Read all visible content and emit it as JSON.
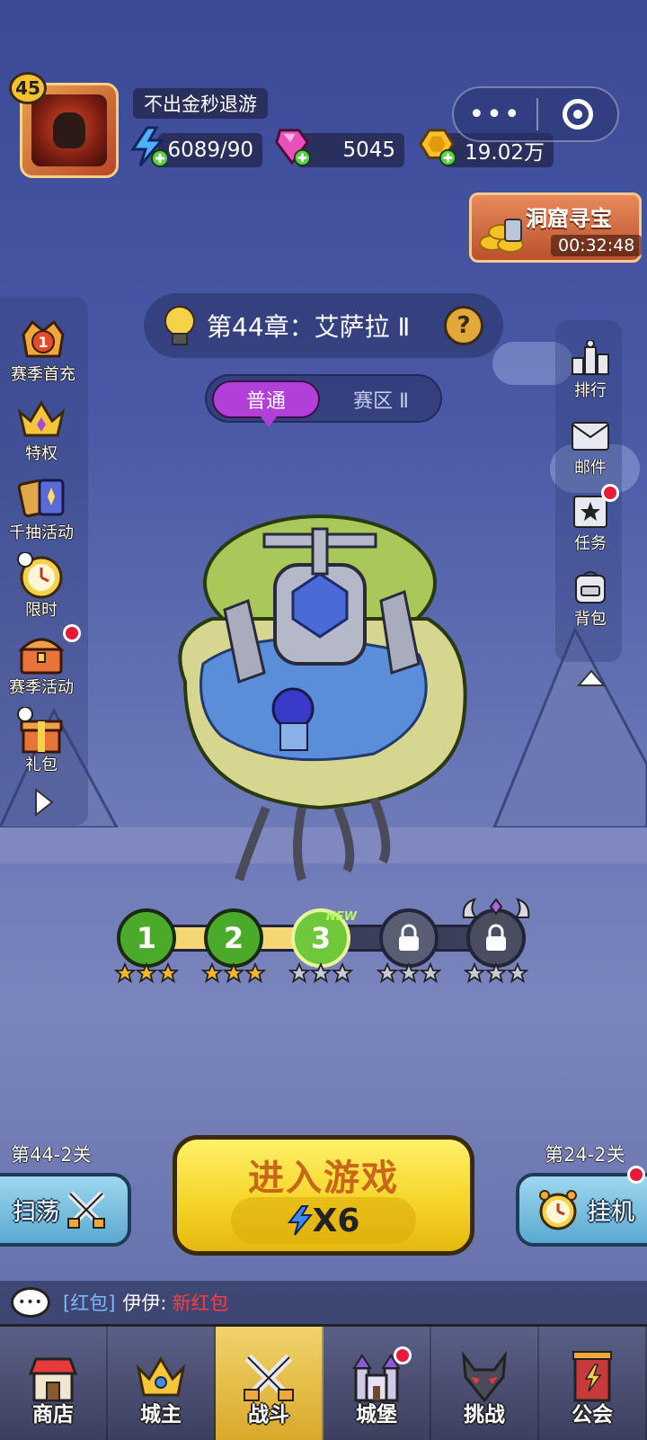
{
  "player": {
    "level": "45",
    "name": "不出金秒退游"
  },
  "resources": {
    "energy": "6089/90",
    "gems": "5045",
    "gold": "19.02万"
  },
  "capsule": {
    "more_icon": "more-dots-icon",
    "close_icon": "target-icon"
  },
  "cave_treasure": {
    "title": "洞窟寻宝",
    "timer": "00:32:48"
  },
  "chapter": {
    "title": "第44章：艾萨拉 Ⅱ",
    "help": "?"
  },
  "mode_tabs": {
    "normal": "普通",
    "zone": "赛区 Ⅱ"
  },
  "left_menu": [
    {
      "label": "赛季首充",
      "icon": "crown-badge-icon",
      "badge": "1"
    },
    {
      "label": "特权",
      "icon": "crown-icon"
    },
    {
      "label": "千抽活动",
      "icon": "cards-icon"
    },
    {
      "label": "限时",
      "icon": "clock-icon"
    },
    {
      "label": "赛季活动",
      "icon": "chest-icon"
    },
    {
      "label": "礼包",
      "icon": "gift-icon"
    }
  ],
  "right_menu": [
    {
      "label": "排行",
      "icon": "ranking-icon"
    },
    {
      "label": "邮件",
      "icon": "mail-icon"
    },
    {
      "label": "任务",
      "icon": "task-icon"
    },
    {
      "label": "背包",
      "icon": "backpack-icon"
    }
  ],
  "stages": [
    {
      "num": "1",
      "stars": 3,
      "state": "cleared"
    },
    {
      "num": "2",
      "stars": 3,
      "state": "cleared"
    },
    {
      "num": "3",
      "stars": 0,
      "state": "current",
      "tag": "NEW"
    },
    {
      "num": "",
      "stars": 0,
      "state": "locked"
    },
    {
      "num": "",
      "stars": 0,
      "state": "boss-locked"
    }
  ],
  "sweep": {
    "level": "第44-2关",
    "label": "扫荡"
  },
  "idle": {
    "level": "第24-2关",
    "label": "挂机"
  },
  "enter": {
    "title": "进入游戏",
    "cost": "X6"
  },
  "chat": {
    "tag": "[红包]",
    "user": "伊伊:",
    "message": "新红包"
  },
  "nav": [
    {
      "label": "商店",
      "icon": "shop-icon"
    },
    {
      "label": "城主",
      "icon": "lord-crown-icon"
    },
    {
      "label": "战斗",
      "icon": "crossed-swords-icon",
      "active": true
    },
    {
      "label": "城堡",
      "icon": "castle-icon"
    },
    {
      "label": "挑战",
      "icon": "demon-mask-icon"
    },
    {
      "label": "公会",
      "icon": "guild-banner-icon"
    }
  ],
  "colors": {
    "accent_purple": "#b13fd8",
    "button_yellow": "#f6d52a",
    "red_dot": "#e8193a"
  }
}
